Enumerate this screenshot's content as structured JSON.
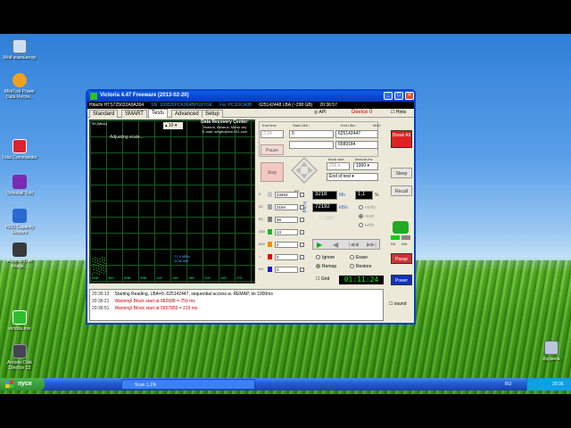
{
  "desktop": {
    "icons": [
      {
        "label": "Мой компьютер"
      },
      {
        "label": "MiniTool Power Data Recov..."
      },
      {
        "label": "Total Commander"
      },
      {
        "label": "Uninstall Tool"
      },
      {
        "label": "HDD Capacity Restore"
      },
      {
        "label": "Acronis True Image..."
      },
      {
        "label": "victoria.exe"
      },
      {
        "label": "Acronis Disk Director 12"
      },
      {
        "label": "Корзина"
      }
    ]
  },
  "taskbar": {
    "start_label": "пуск",
    "task_label": "Scan 1,1%",
    "lang": "RU",
    "clock": "20:36"
  },
  "window": {
    "title": "Victoria 4.47  Freeware (2013-02-20)",
    "info": {
      "model": "Hitachi HTS725032A9A364",
      "sn": "SN: 100826PCK004BPG9YGK",
      "fw": "Fw: PC3OCA0B",
      "lba": "625142448 LBA  (~298 GB)",
      "time": "20:36:57"
    },
    "tabs": [
      "Standard",
      "SMART",
      "Tests",
      "Advanced",
      "Setup"
    ],
    "device": "Device 0",
    "hints": "Hints",
    "graph": {
      "ytick": "99 (Mb/s)",
      "spin_value": "10",
      "adjusting": "Adjusting scale...",
      "rate1": "77,4 MB/s",
      "rate2": "3136 MB",
      "xticks": [
        "0GB",
        "3KG",
        "6GB",
        "9GB",
        "12G",
        "15G",
        "18G",
        "21G",
        "24G",
        "27G"
      ],
      "ddc_title": "Data Recovery Center:",
      "ddc_line1": "Victoria, Belarus, Minsk city",
      "ddc_line2": "E-mail: sergei@ddr-911.com"
    },
    "controls": {
      "end_time_label": "End time",
      "start_lba_label": "Start LBA :",
      "end_lba_label": "End LBA :",
      "max_label": "MAX",
      "end_time": "2:24",
      "start_lba": "0",
      "end_lba": "625142447",
      "pos_lba": "6589184",
      "pause": "Pause",
      "stop": "Stop",
      "block_size_label": "block size",
      "timeout_label": "timeout,ms",
      "block_size": "256",
      "timeout": "1000",
      "end_of_test": "End of test",
      "blocks": [
        {
          "label": "5",
          "value": "23464",
          "color": "#c8c8c8"
        },
        {
          "label": "20",
          "value": "2194",
          "color": "#a0a0a0"
        },
        {
          "label": "50",
          "value": "46",
          "color": "#7f7f7f"
        },
        {
          "label": "200",
          "value": "13",
          "color": "#23b023"
        },
        {
          "label": "600",
          "value": "2",
          "color": "#f08a00"
        },
        {
          "label": ">",
          "value": "0",
          "color": "#e00000"
        },
        {
          "label": "Err",
          "value": "0",
          "color": "#1a1ad0"
        }
      ],
      "rs_label": "RS",
      "to_log": "to log:",
      "mb_value": "3218",
      "mb_unit": "Mb",
      "percent": "1,1",
      "percent_unit": "%",
      "kbs_value": "72192",
      "kbs_unit": "kB/s",
      "verify": "verify",
      "read": "read",
      "write": "write",
      "ddd": "DDD",
      "ignore": "Ignore",
      "erase": "Erase",
      "remap": "Remap",
      "restore": "Restore",
      "grid": "Grid",
      "timer": "01:11:24"
    },
    "side_buttons": {
      "break_all": "Break All",
      "sleep": "Sleep",
      "recall": "Recall",
      "rd": "Rd",
      "wrt": "Wrt",
      "passp": "Passp",
      "power": "Power",
      "sound": "sound",
      "api": "API"
    },
    "log": [
      {
        "time": "20:36:13",
        "text": "Starting Reading, LBA=0..625142447, sequential access w. REMAP, tio 1000ms",
        "color": "#000000"
      },
      {
        "time": "20:36:21",
        "text": "Warning! Block start at 882688 = 750 ms",
        "color": "#cc0000"
      },
      {
        "time": "20:36:51",
        "text": "Warning! Block start at 5657856 = 219 ms",
        "color": "#cc0000"
      }
    ]
  },
  "recycle": {
    "label": "Корзина"
  }
}
